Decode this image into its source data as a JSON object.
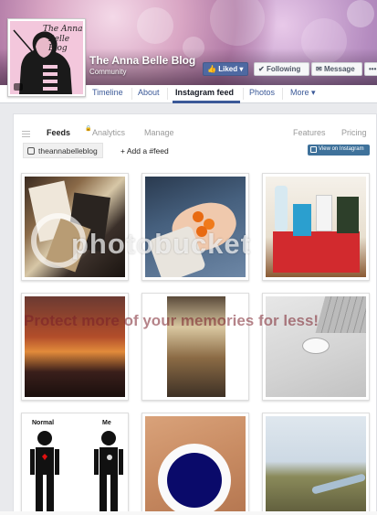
{
  "cover": {
    "page_name": "The Anna Belle Blog",
    "category": "Community"
  },
  "profile_pic": {
    "line1": "The Anna",
    "line2": "Belle Blog"
  },
  "actions": {
    "liked": "Liked",
    "following": "Following",
    "message": "Message",
    "more": "•••"
  },
  "tabs": [
    {
      "label": "Timeline"
    },
    {
      "label": "About"
    },
    {
      "label": "Instagram feed"
    },
    {
      "label": "Photos"
    },
    {
      "label": "More ▾"
    }
  ],
  "app_nav": {
    "feeds": "Feeds",
    "analytics": "Analytics",
    "manage": "Manage",
    "features": "Features",
    "pricing": "Pricing"
  },
  "account": {
    "handle": "theannabelleblog",
    "add_feed": "+ Add a #feed",
    "view_instagram": "View on Instagram"
  },
  "watermark": {
    "brand": "photobucket",
    "tagline": "Protect more of your memories for less!"
  },
  "grid": {
    "row3_left_labels": {
      "normal": "Normal",
      "me": "Me"
    }
  },
  "colors": {
    "facebook_blue": "#3b5998",
    "liked_blue": "#4e69a2",
    "instagram_blue": "#3f729b"
  }
}
